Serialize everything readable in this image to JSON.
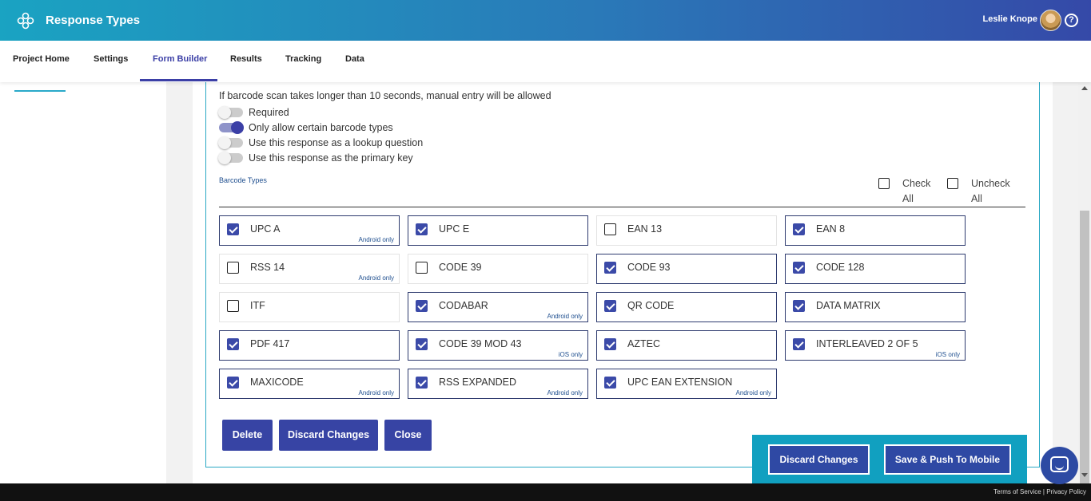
{
  "header": {
    "title": "Response Types",
    "user_name": "Leslie Knope",
    "help_glyph": "?"
  },
  "nav": {
    "items": [
      {
        "label": "Project Home"
      },
      {
        "label": "Settings"
      },
      {
        "label": "Form Builder",
        "active": true
      },
      {
        "label": "Results"
      },
      {
        "label": "Tracking"
      },
      {
        "label": "Data"
      }
    ]
  },
  "form": {
    "info_text": "If barcode scan takes longer than 10 seconds, manual entry will be allowed",
    "toggles": [
      {
        "label": "Required",
        "on": false
      },
      {
        "label": "Only allow certain barcode types",
        "on": true
      },
      {
        "label": "Use this response as a lookup question",
        "on": false
      },
      {
        "label": "Use this response as the primary key",
        "on": false
      }
    ],
    "section_label": "Barcode Types",
    "check_all": "Check All",
    "uncheck_all": "Uncheck All",
    "barcode_types": [
      {
        "name": "UPC A",
        "checked": true,
        "note": "Android only"
      },
      {
        "name": "UPC E",
        "checked": true,
        "note": ""
      },
      {
        "name": "EAN 13",
        "checked": false,
        "note": ""
      },
      {
        "name": "EAN 8",
        "checked": true,
        "note": ""
      },
      {
        "name": "RSS 14",
        "checked": false,
        "note": "Android only"
      },
      {
        "name": "CODE 39",
        "checked": false,
        "note": ""
      },
      {
        "name": "CODE 93",
        "checked": true,
        "note": ""
      },
      {
        "name": "CODE 128",
        "checked": true,
        "note": ""
      },
      {
        "name": "ITF",
        "checked": false,
        "note": ""
      },
      {
        "name": "CODABAR",
        "checked": true,
        "note": "Android only"
      },
      {
        "name": "QR CODE",
        "checked": true,
        "note": ""
      },
      {
        "name": "DATA MATRIX",
        "checked": true,
        "note": ""
      },
      {
        "name": "PDF 417",
        "checked": true,
        "note": ""
      },
      {
        "name": "CODE 39 MOD 43",
        "checked": true,
        "note": "iOS only"
      },
      {
        "name": "AZTEC",
        "checked": true,
        "note": ""
      },
      {
        "name": "INTERLEAVED 2 OF 5",
        "checked": true,
        "note": "iOS only"
      },
      {
        "name": "MAXICODE",
        "checked": true,
        "note": "Android only"
      },
      {
        "name": "RSS EXPANDED",
        "checked": true,
        "note": "Android only"
      },
      {
        "name": "UPC EAN EXTENSION",
        "checked": true,
        "note": "Android only"
      }
    ],
    "buttons": {
      "delete": "Delete",
      "discard": "Discard Changes",
      "close": "Close"
    }
  },
  "bottom_bar": {
    "discard": "Discard Changes",
    "save_push": "Save & Push To Mobile"
  },
  "footer": {
    "links": "Terms of Service | Privacy Policy"
  },
  "colors": {
    "accent": "#3744a4",
    "header_start": "#1aa3c2",
    "header_end": "#3549a8",
    "bottom_bar": "#11a0c0"
  }
}
